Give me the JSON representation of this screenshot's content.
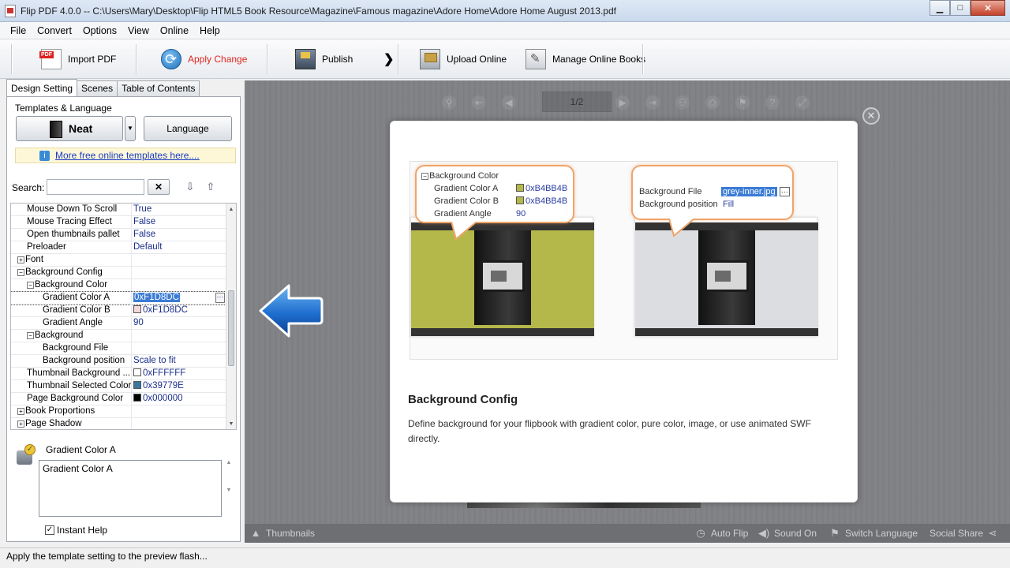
{
  "window": {
    "title": "Flip PDF 4.0.0  -- C:\\Users\\Mary\\Desktop\\Flip HTML5 Book Resource\\Magazine\\Famous magazine\\Adore Home\\Adore Home August 2013.pdf",
    "min_label": "▁",
    "max_label": "□",
    "close_label": "✕"
  },
  "menu": [
    "File",
    "Convert",
    "Options",
    "View",
    "Online",
    "Help"
  ],
  "toolbar": {
    "import_label": "Import PDF",
    "apply_label": "Apply Change",
    "publish_label": "Publish",
    "more_label": "❯",
    "upload_label": "Upload Online",
    "manage_label": "Manage Online Books",
    "apply_color": "#e0261f"
  },
  "left": {
    "tabs": [
      "Design Setting",
      "Scenes",
      "Table of Contents"
    ],
    "templates_label": "Templates & Language",
    "template_name": "Neat",
    "template_dropdown": "▼",
    "language_label": "Language",
    "more_templates": "More free online templates here....",
    "search_label": "Search:",
    "search_value": "",
    "search_clear": "✕",
    "properties": [
      {
        "name": "Mouse Down To Scroll",
        "value": "True",
        "indent": 0,
        "expander": ""
      },
      {
        "name": "Mouse Tracing Effect",
        "value": "False",
        "indent": 0,
        "expander": ""
      },
      {
        "name": "Open thumbnails pallet",
        "value": "False",
        "indent": 0,
        "expander": ""
      },
      {
        "name": "Preloader",
        "value": "Default",
        "indent": 0,
        "expander": ""
      },
      {
        "name": "Font",
        "value": "",
        "indent": -1,
        "expander": "+"
      },
      {
        "name": "Background Config",
        "value": "",
        "indent": -1,
        "expander": "−"
      },
      {
        "name": "Background Color",
        "value": "",
        "indent": 0,
        "expander": "−"
      },
      {
        "name": "Gradient Color A",
        "value": "0xF1D8DC",
        "indent": 1,
        "expander": "",
        "swatch": "",
        "selected": true
      },
      {
        "name": "Gradient Color B",
        "value": "0xF1D8DC",
        "indent": 1,
        "expander": "",
        "swatch": "#f1d8dc"
      },
      {
        "name": "Gradient Angle",
        "value": "90",
        "indent": 1,
        "expander": ""
      },
      {
        "name": "Background",
        "value": "",
        "indent": 0,
        "expander": "−"
      },
      {
        "name": "Background File",
        "value": "",
        "indent": 1,
        "expander": ""
      },
      {
        "name": "Background position",
        "value": "Scale to fit",
        "indent": 1,
        "expander": ""
      },
      {
        "name": "Thumbnail Background ...",
        "value": "0xFFFFFF",
        "indent": 0,
        "expander": "",
        "swatch": "#ffffff"
      },
      {
        "name": "Thumbnail Selected Color",
        "value": "0x39779E",
        "indent": 0,
        "expander": "",
        "swatch": "#39779e"
      },
      {
        "name": "Page Background Color",
        "value": "0x000000",
        "indent": 0,
        "expander": "",
        "swatch": "#000000"
      },
      {
        "name": "Book Proportions",
        "value": "",
        "indent": -1,
        "expander": "+"
      },
      {
        "name": "Page Shadow",
        "value": "",
        "indent": -1,
        "expander": "+"
      }
    ],
    "help_title": "Gradient Color A",
    "help_text": "Gradient Color A",
    "instant_help_label": "Instant Help",
    "instant_help_checked": "✓"
  },
  "viewer": {
    "page_indicator": "1/2",
    "close_label": "✕",
    "card": {
      "bubble1": {
        "header": "Background Color",
        "rows": [
          {
            "name": "Gradient Color A",
            "value": "0xB4BB4B",
            "swatch": true
          },
          {
            "name": "Gradient Color B",
            "value": "0xB4BB4B",
            "swatch": true
          },
          {
            "name": "Gradient Angle",
            "value": "90",
            "swatch": false
          }
        ]
      },
      "bubble2": {
        "rows": [
          {
            "name": "Background File",
            "value": "grey-inner.jpg"
          },
          {
            "name": "Background position",
            "value": "Fill"
          }
        ]
      },
      "left_preview_color": "#b4b84b",
      "right_preview_color": "#dcdde0",
      "title": "Background Config",
      "description": "Define background for your flipbook with gradient color, pure color, image, or use animated SWF directly."
    },
    "bottom": {
      "thumbnails": "Thumbnails",
      "auto_flip": "Auto Flip",
      "sound_on": "Sound On",
      "switch_language": "Switch Language",
      "social_share": "Social Share"
    }
  },
  "status": "Apply the template setting to the preview flash..."
}
